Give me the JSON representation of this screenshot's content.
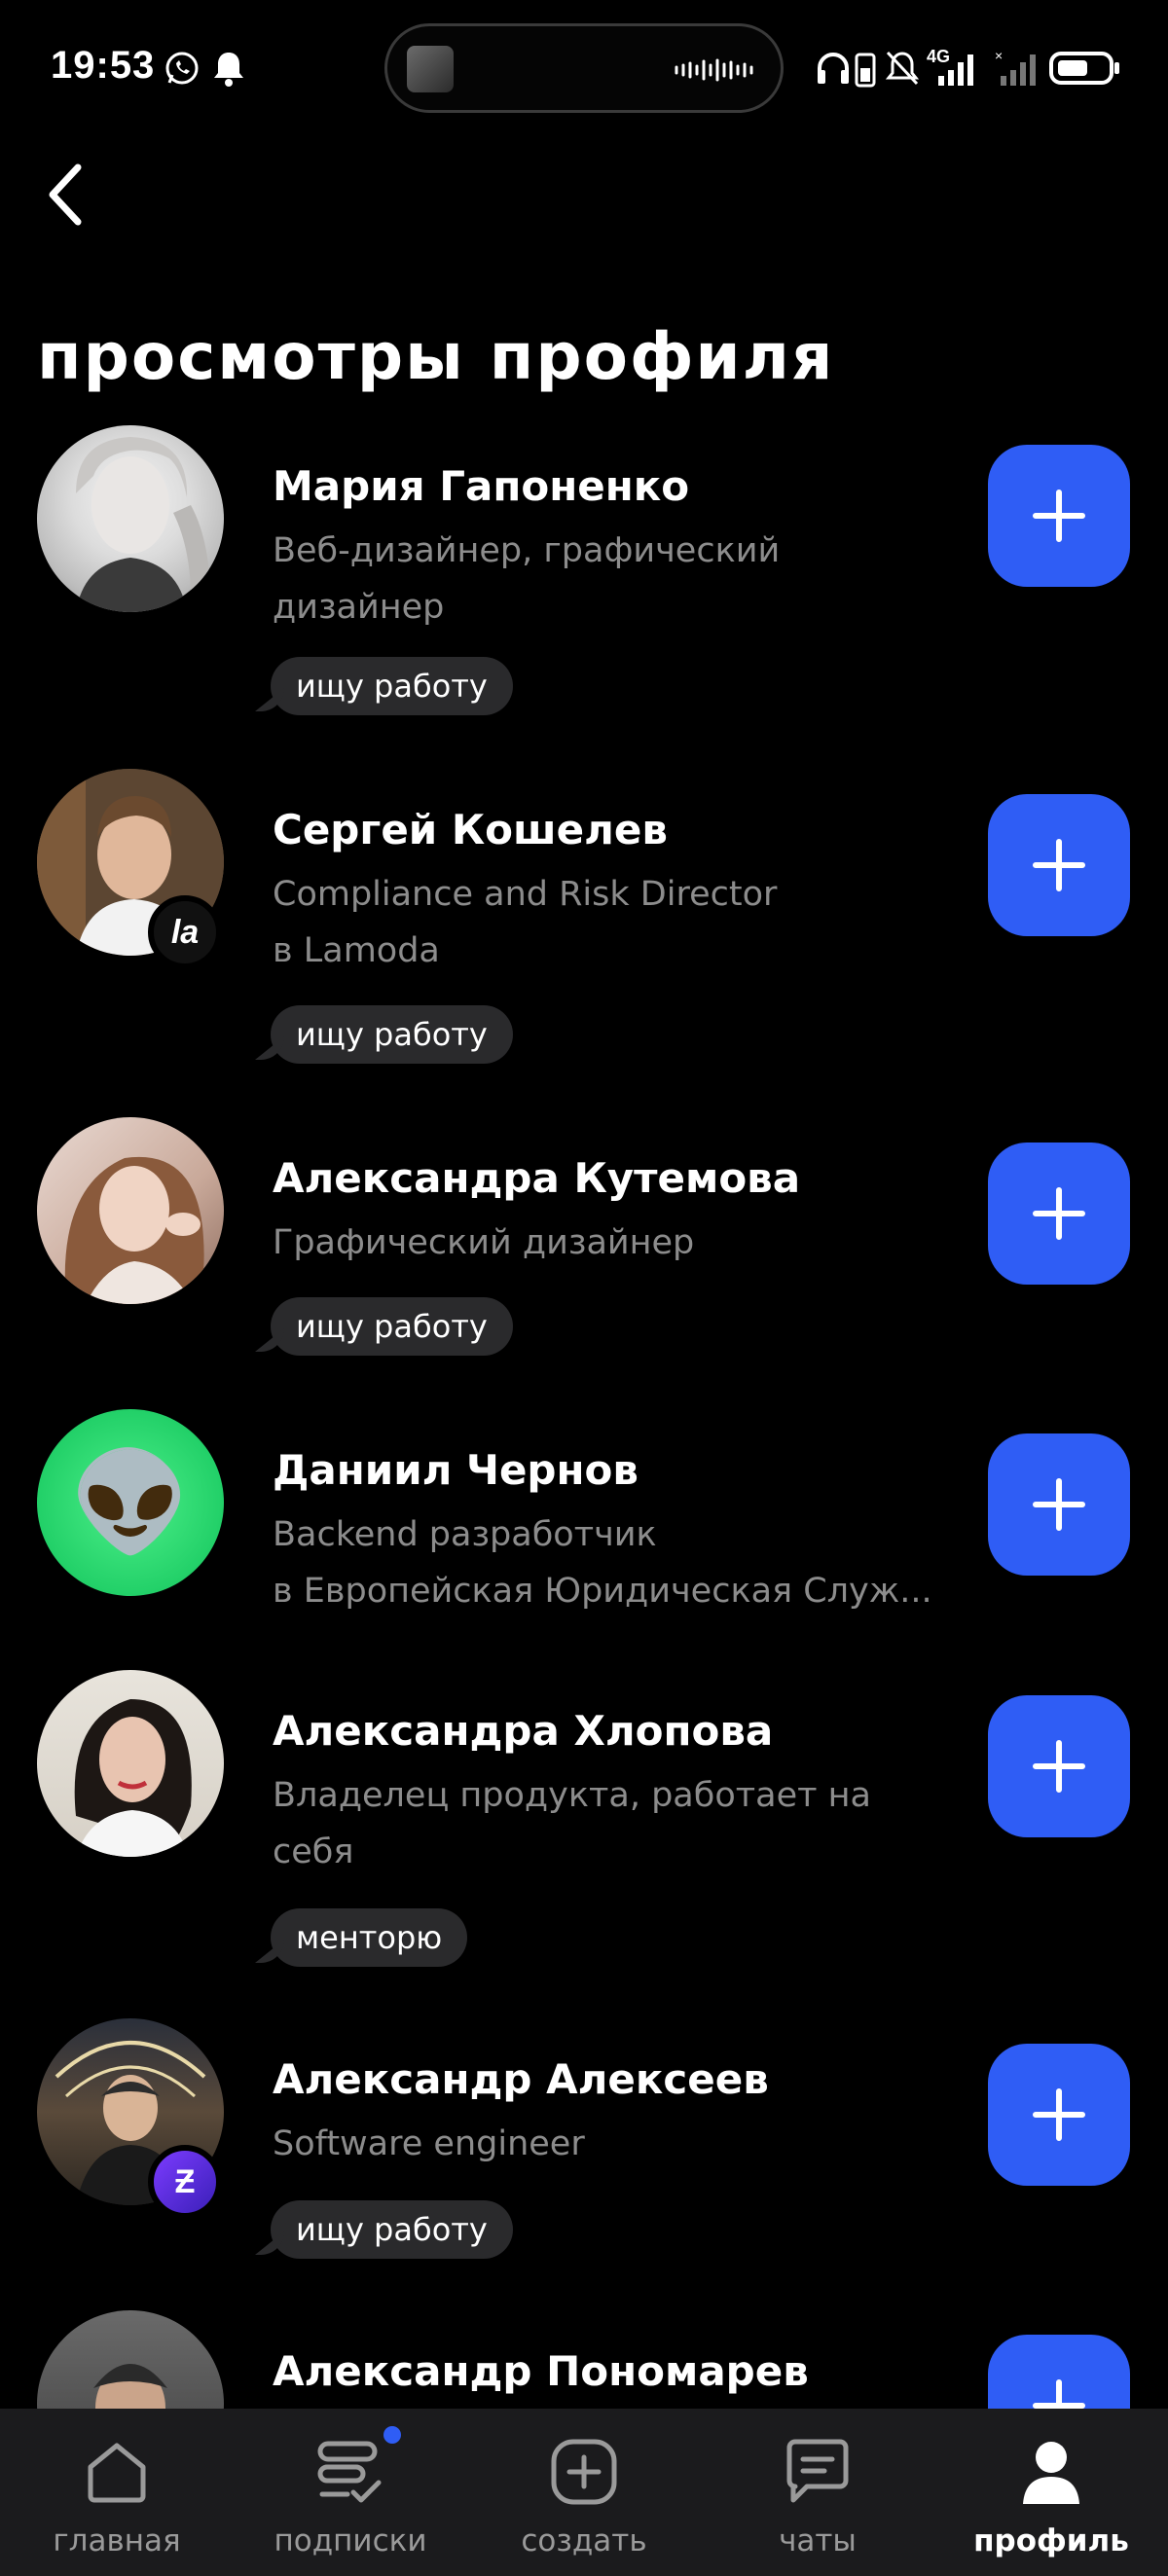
{
  "status_bar": {
    "time": "19:53",
    "network_label": "4G"
  },
  "header": {
    "title": "просмотры профиля"
  },
  "profiles": [
    {
      "name": "Мария Гапоненко",
      "subtitle_lines": [
        "Веб-дизайнер, графический",
        "дизайнер"
      ],
      "tag": "ищу работу",
      "badge": ""
    },
    {
      "name": "Сергей Кошелев",
      "subtitle_lines": [
        "Compliance and Risk Director",
        "в Lamoda"
      ],
      "tag": "ищу работу",
      "badge": "la"
    },
    {
      "name": "Александра Кутемова",
      "subtitle_lines": [
        "Графический дизайнер"
      ],
      "tag": "ищу работу",
      "badge": ""
    },
    {
      "name": "Даниил Чернов",
      "subtitle_lines": [
        "Backend разработчик",
        "в Европейская Юридическая Служ..."
      ],
      "tag": "",
      "badge": "",
      "avatar_emoji": "👽"
    },
    {
      "name": "Александра Хлопова",
      "subtitle_lines": [
        "Владелец продукта, работает на",
        "себя"
      ],
      "tag": "менторю",
      "badge": ""
    },
    {
      "name": "Александр Алексеев",
      "subtitle_lines": [
        "Software engineer"
      ],
      "tag": "ищу работу",
      "badge": "Ƶ"
    },
    {
      "name": "Александр Пономарев",
      "subtitle_lines": [],
      "tag": "",
      "badge": ""
    }
  ],
  "bottom_nav": {
    "items": [
      {
        "label": "главная",
        "icon": "home-icon"
      },
      {
        "label": "подписки",
        "icon": "subscriptions-icon"
      },
      {
        "label": "создать",
        "icon": "create-icon"
      },
      {
        "label": "чаты",
        "icon": "chats-icon"
      },
      {
        "label": "профиль",
        "icon": "profile-icon"
      }
    ],
    "active_index": 4
  },
  "colors": {
    "background": "#000000",
    "accent": "#2f5df5",
    "tag_bg": "#2a2a2c",
    "subtitle": "#8c8c8c",
    "nav_bg": "#1b1b1d"
  }
}
